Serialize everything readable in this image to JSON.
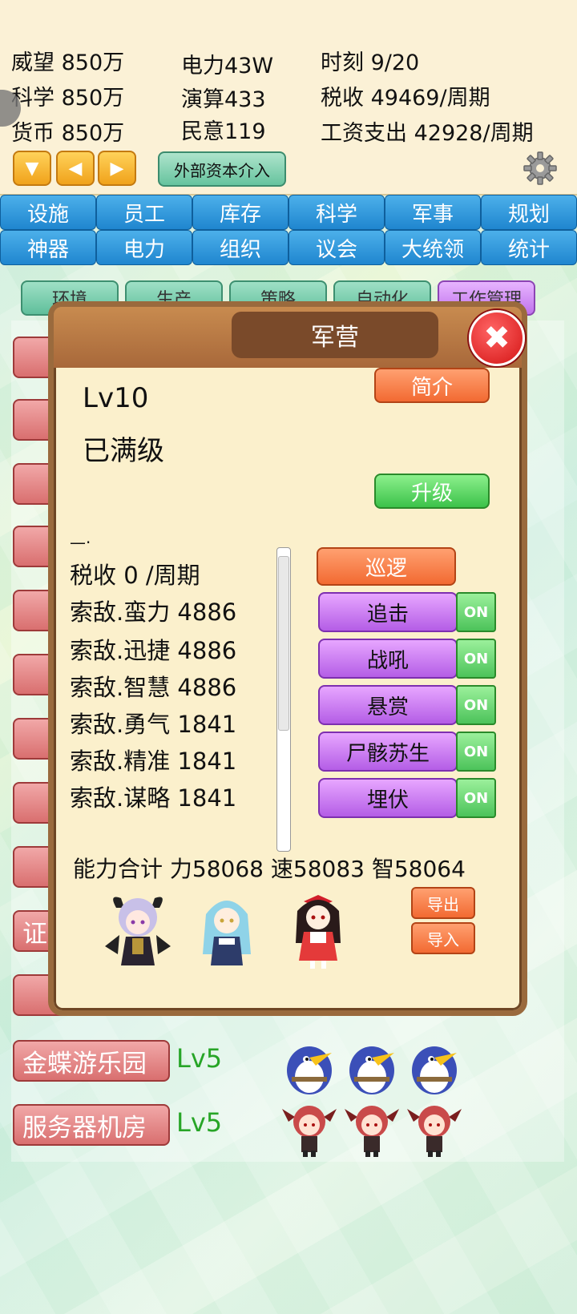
{
  "stats": {
    "prestige": "威望 850万",
    "science": "科学 850万",
    "currency": "货币 850万",
    "power": "电力43W",
    "compute": "演算433",
    "public_opinion": "民意119",
    "time": "时刻 9/20",
    "tax": "税收 49469/周期",
    "wages": "工资支出 42928/周期"
  },
  "controls": {
    "capital_btn": "外部资本介入"
  },
  "tabs": [
    "设施",
    "员工",
    "库存",
    "科学",
    "军事",
    "规划",
    "神器",
    "电力",
    "组织",
    "议会",
    "大统领",
    "统计"
  ],
  "subtabs": [
    "环境",
    "生产",
    "策略",
    "自动化",
    "工作管理"
  ],
  "list": [
    {
      "label": "证",
      "lv": ""
    },
    {
      "label": "金蝶游乐园",
      "lv": "Lv5"
    },
    {
      "label": "服务器机房",
      "lv": "Lv5"
    }
  ],
  "modal": {
    "title": "军营",
    "level": "Lv10",
    "max_status": "已满级",
    "intro_btn": "简介",
    "upgrade_btn": "升级",
    "dash": "—·",
    "info_lines": [
      "税收 0 /周期",
      "索敌.蛮力 4886",
      "索敌.迅捷 4886",
      "索敌.智慧 4886",
      "索敌.勇气 1841",
      "索敌.精准 1841",
      "索敌.谋略 1841"
    ],
    "patrol_btn": "巡逻",
    "actions": [
      {
        "label": "追击",
        "toggle": "ON"
      },
      {
        "label": "战吼",
        "toggle": "ON"
      },
      {
        "label": "悬赏",
        "toggle": "ON"
      },
      {
        "label": "尸骸苏生",
        "toggle": "ON"
      },
      {
        "label": "埋伏",
        "toggle": "ON"
      }
    ],
    "total": "能力合计 力58068 速58083 智58064",
    "export_btn": "导出",
    "import_btn": "导入"
  }
}
